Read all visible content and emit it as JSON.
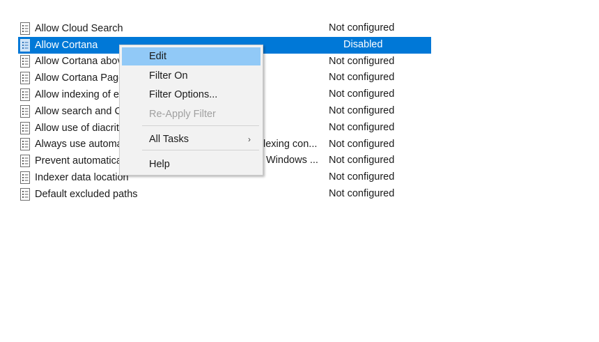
{
  "policies": [
    {
      "name": "Allow Cloud Search",
      "state": "Not configured"
    },
    {
      "name": "Allow Cortana",
      "state": "Disabled",
      "selected": true
    },
    {
      "name": "Allow Cortana abov",
      "state": "Not configured"
    },
    {
      "name": "Allow Cortana Page",
      "state": "Not configured"
    },
    {
      "name": "Allow indexing of e",
      "state": "Not configured"
    },
    {
      "name": "Allow search and C",
      "state": "Not configured"
    },
    {
      "name": "Allow use of diacrit",
      "state": "Not configured"
    },
    {
      "name": "Always use automa",
      "state": "Not configured",
      "trailing_fragment": "lexing con..."
    },
    {
      "name": "Prevent automatica",
      "state": "Not configured",
      "trailing_fragment": "Windows ..."
    },
    {
      "name": "Indexer data location",
      "state": "Not configured"
    },
    {
      "name": "Default excluded paths",
      "state": "Not configured"
    }
  ],
  "context_menu": {
    "items": [
      {
        "label": "Edit",
        "highlighted": true
      },
      {
        "label": "Filter On"
      },
      {
        "label": "Filter Options..."
      },
      {
        "label": "Re-Apply Filter",
        "disabled": true
      },
      {
        "label": "All Tasks",
        "submenu_glyph": "›"
      },
      {
        "label": "Help"
      }
    ]
  },
  "icons": {
    "policy": "policy-setting-icon",
    "submenu": "chevron-right-icon"
  },
  "colors": {
    "selection": "#0078d7",
    "menu_highlight": "#91c9f7",
    "menu_background": "#f2f2f2",
    "disabled_text": "#a0a0a0"
  }
}
